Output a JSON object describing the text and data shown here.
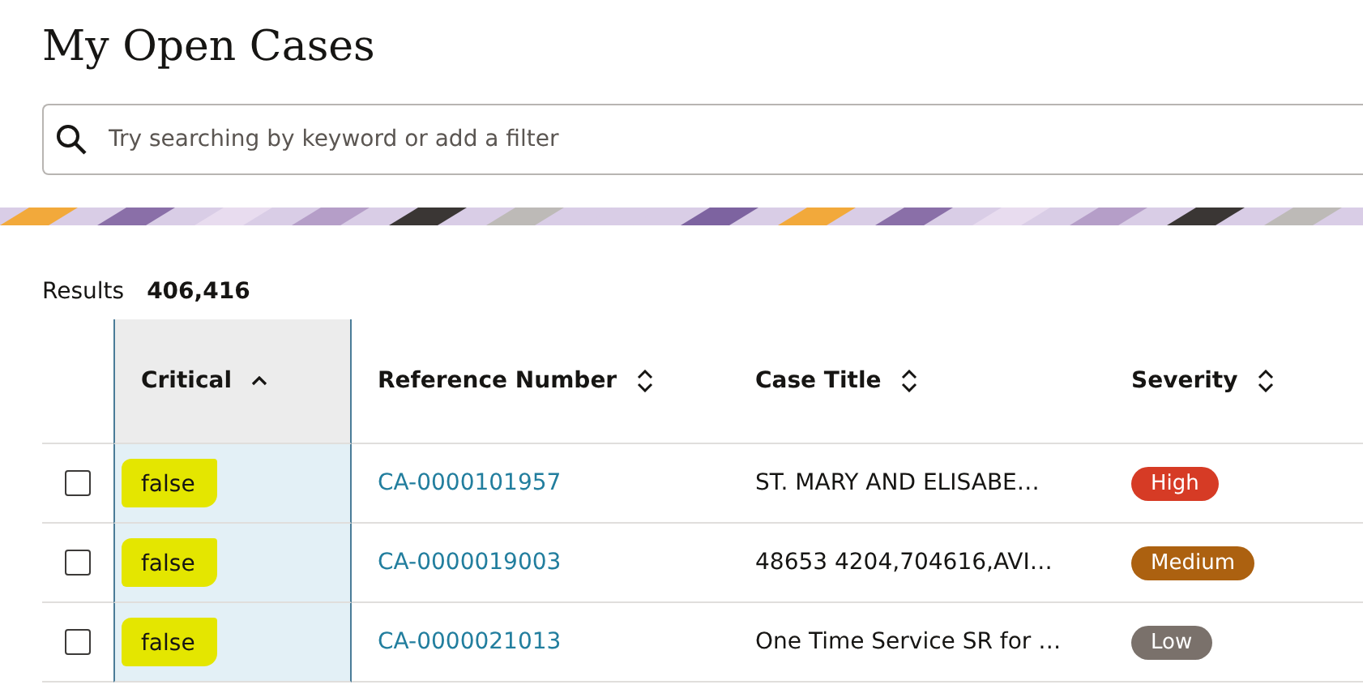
{
  "page": {
    "title": "My Open Cases"
  },
  "search": {
    "placeholder": "Try searching by keyword or add a filter"
  },
  "results": {
    "label": "Results",
    "count": "406,416"
  },
  "table": {
    "columns": [
      {
        "label": "Critical",
        "sorted": true,
        "selected": true
      },
      {
        "label": "Reference Number",
        "sorted": false,
        "selected": false
      },
      {
        "label": "Case Title",
        "sorted": false,
        "selected": false
      },
      {
        "label": "Severity",
        "sorted": false,
        "selected": false
      }
    ],
    "rows": [
      {
        "checked": false,
        "critical": "false",
        "reference": "CA-0000101957",
        "title": "ST. MARY AND ELISABE…",
        "severity": "High",
        "color": "#d63b25"
      },
      {
        "checked": false,
        "critical": "false",
        "reference": "CA-0000019003",
        "title": "48653 4204,704616,AVI…",
        "severity": "Medium",
        "color": "#ac6110"
      },
      {
        "checked": false,
        "critical": "false",
        "reference": "CA-0000021013",
        "title": "One Time Service SR for …",
        "severity": "Low",
        "color": "#7a716b"
      }
    ]
  }
}
